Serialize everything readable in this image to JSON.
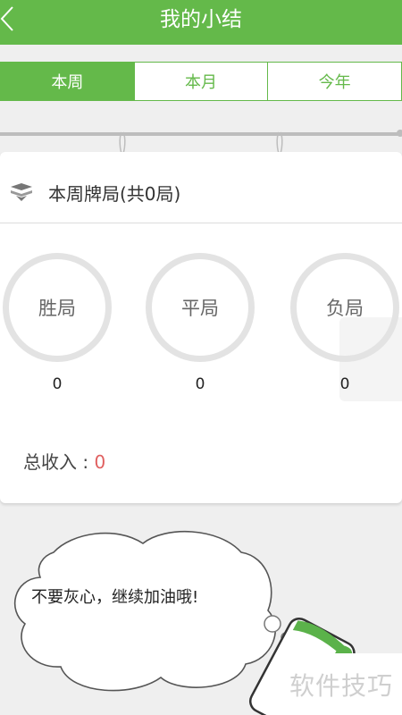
{
  "header": {
    "title": "我的小结"
  },
  "tabs": [
    {
      "label": "本周",
      "active": true
    },
    {
      "label": "本月",
      "active": false
    },
    {
      "label": "今年",
      "active": false
    }
  ],
  "summary": {
    "title": "本周牌局(共0局)",
    "stats": [
      {
        "label": "胜局",
        "count": "0"
      },
      {
        "label": "平局",
        "count": "0"
      },
      {
        "label": "负局",
        "count": "0"
      }
    ],
    "income_label": "总收入 : ",
    "income_value": "0"
  },
  "mascot": {
    "bubble_text": "不要灰心，继续加油哦!"
  },
  "watermark": "软件技巧",
  "colors": {
    "brand": "#64b94a",
    "ring": "#e3e3e3",
    "income": "#e06060"
  }
}
